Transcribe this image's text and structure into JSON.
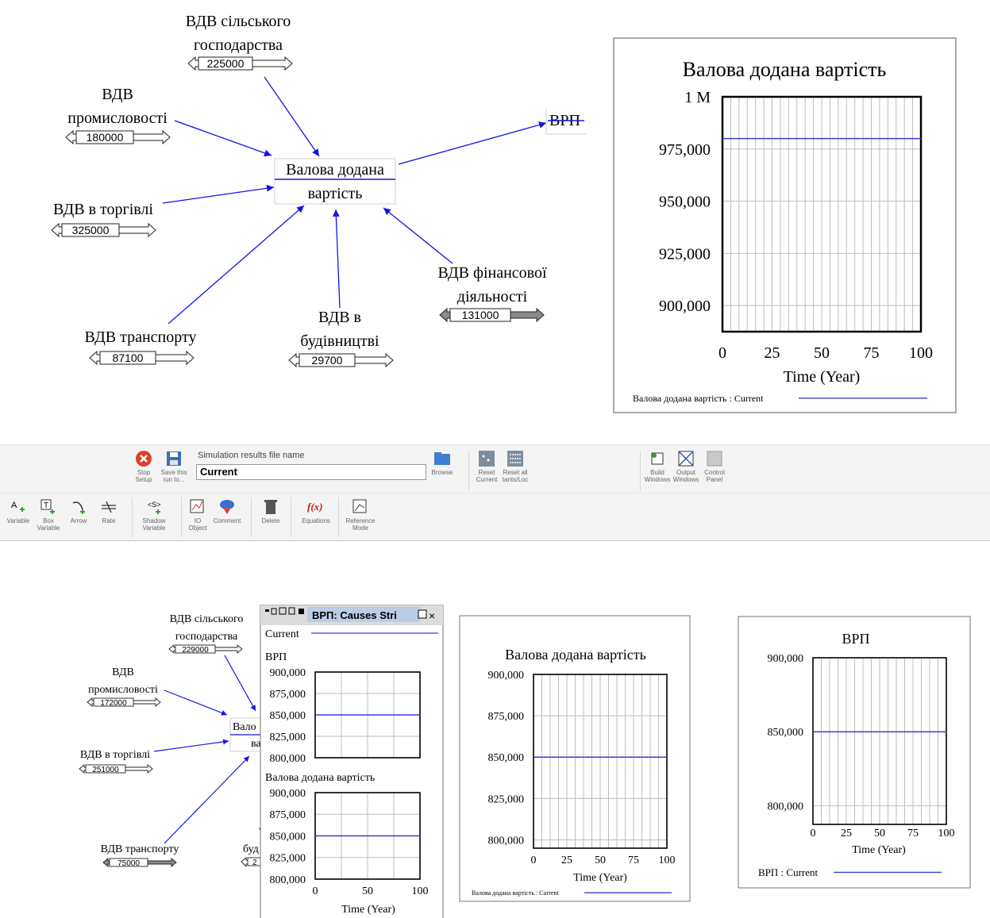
{
  "top_diagram": {
    "central": {
      "line1": "Валова додана",
      "line2": "вартість"
    },
    "output": "ВРП",
    "inputs": [
      {
        "id": "agri",
        "name_lines": [
          "ВДВ сільського",
          "господарства"
        ],
        "value": "225000"
      },
      {
        "id": "ind",
        "name_lines": [
          "ВДВ",
          "промисловості"
        ],
        "value": "180000"
      },
      {
        "id": "trade",
        "name_lines": [
          "ВДВ в торгівлі"
        ],
        "value": "325000"
      },
      {
        "id": "trans",
        "name_lines": [
          "ВДВ транспорту"
        ],
        "value": "87100"
      },
      {
        "id": "build",
        "name_lines": [
          "ВДВ в",
          "будівництві"
        ],
        "value": "29700"
      },
      {
        "id": "fin",
        "name_lines": [
          "ВДВ фінансової",
          "діяльності"
        ],
        "value": "131000"
      }
    ]
  },
  "toolbar": {
    "stop_label": "Stop Setup",
    "save_label": "Save this run to...",
    "simfile_caption": "Simulation results file name",
    "simfile_value": "Current",
    "browse_label": "Browse",
    "reset_current_label": "Reset Current",
    "reset_all_label": "Reset all tants/Loc",
    "build_windows_label": "Build Windows",
    "output_windows_label": "Output Windows",
    "control_panel_label": "Control Panel",
    "variable_label": "Variable",
    "box_variable_label": "Box Variable",
    "arrow_label": "Arrow",
    "rate_label": "Rate",
    "shadow_variable_label": "Shadow Variable",
    "io_object_label": "IO Object",
    "comment_label": "Comment",
    "delete_label": "Delete",
    "equations_label": "Equations",
    "reference_mode_label": "Reference Mode"
  },
  "bottom_diagram": {
    "central_partial": {
      "line1": "Вало",
      "line2": "ва"
    },
    "inputs": [
      {
        "id": "agri2",
        "name_lines": [
          "ВДВ сільського",
          "господарства"
        ],
        "value": "229000"
      },
      {
        "id": "ind2",
        "name_lines": [
          "ВДВ",
          "промисловості"
        ],
        "value": "172000"
      },
      {
        "id": "trade2",
        "name_lines": [
          "ВДВ в торгівлі"
        ],
        "value": "251000"
      },
      {
        "id": "trans2",
        "name_lines": [
          "ВДВ транспорту"
        ],
        "value": "75000"
      }
    ],
    "partial_label": "буд",
    "partial_value": "2"
  },
  "causes_window": {
    "title": "ВРП: Causes Stri",
    "legend_label": "Current",
    "panel1_title": "ВРП",
    "panel2_title": "Валова додана вартість",
    "xlabel": "Time (Year)"
  },
  "chart_data": [
    {
      "type": "line",
      "title": "Валова додана вартість",
      "xlabel": "Time (Year)",
      "ylabel": "",
      "xlim": [
        0,
        100
      ],
      "ylim": [
        887500,
        1000000
      ],
      "y_ticks": [
        {
          "v": 1000000,
          "label": "1 M"
        },
        {
          "v": 975000,
          "label": "975,000"
        },
        {
          "v": 950000,
          "label": "950,000"
        },
        {
          "v": 925000,
          "label": "925,000"
        },
        {
          "v": 900000,
          "label": "900,000"
        }
      ],
      "x_ticks": [
        0,
        25,
        50,
        75,
        100
      ],
      "grid": true,
      "legend_text": "Валова додана вартість : Current",
      "series": [
        {
          "name": "Валова додана вартість : Current",
          "color": "#3b3bd6",
          "x": [
            0,
            100
          ],
          "y": [
            980000,
            980000
          ]
        }
      ]
    },
    {
      "type": "line",
      "title": "ВРП",
      "xlabel": "Time (Year)",
      "xlim": [
        0,
        100
      ],
      "ylim": [
        800000,
        900000
      ],
      "y_ticks": [
        {
          "v": 900000,
          "label": "900,000"
        },
        {
          "v": 875000,
          "label": "875,000"
        },
        {
          "v": 850000,
          "label": "850,000"
        },
        {
          "v": 825000,
          "label": "825,000"
        },
        {
          "v": 800000,
          "label": "800,000"
        }
      ],
      "x_ticks": [
        0,
        50,
        100
      ],
      "grid": true,
      "series": [
        {
          "name": "Current",
          "color": "#3b3bd6",
          "x": [
            0,
            100
          ],
          "y": [
            850000,
            850000
          ]
        }
      ]
    },
    {
      "type": "line",
      "title": "Валова додана вартість",
      "xlabel": "Time (Year)",
      "xlim": [
        0,
        100
      ],
      "ylim": [
        800000,
        900000
      ],
      "y_ticks": [
        {
          "v": 900000,
          "label": "900,000"
        },
        {
          "v": 875000,
          "label": "875,000"
        },
        {
          "v": 850000,
          "label": "850,000"
        },
        {
          "v": 825000,
          "label": "825,000"
        },
        {
          "v": 800000,
          "label": "800,000"
        }
      ],
      "x_ticks": [
        0,
        50,
        100
      ],
      "grid": true,
      "series": [
        {
          "name": "Current",
          "color": "#3b3bd6",
          "x": [
            0,
            100
          ],
          "y": [
            850000,
            850000
          ]
        }
      ]
    },
    {
      "type": "line",
      "title": "Валова додана вартість",
      "xlabel": "Time (Year)",
      "xlim": [
        0,
        100
      ],
      "ylim": [
        795000,
        900000
      ],
      "y_ticks": [
        {
          "v": 900000,
          "label": "900,000"
        },
        {
          "v": 875000,
          "label": "875,000"
        },
        {
          "v": 850000,
          "label": "850,000"
        },
        {
          "v": 825000,
          "label": "825,000"
        },
        {
          "v": 800000,
          "label": "800,000"
        }
      ],
      "x_ticks": [
        0,
        25,
        50,
        75,
        100
      ],
      "grid": true,
      "legend_text": "Валова додана вартість : Current",
      "series": [
        {
          "name": "Валова додана вартість : Current",
          "color": "#3b3bd6",
          "x": [
            0,
            100
          ],
          "y": [
            850000,
            850000
          ]
        }
      ]
    },
    {
      "type": "line",
      "title": "ВРП",
      "xlabel": "Time (Year)",
      "xlim": [
        0,
        100
      ],
      "ylim": [
        787500,
        900000
      ],
      "y_ticks": [
        {
          "v": 900000,
          "label": "900,000"
        },
        {
          "v": 850000,
          "label": "850,000"
        },
        {
          "v": 800000,
          "label": "800,000"
        }
      ],
      "x_ticks": [
        0,
        25,
        50,
        75,
        100
      ],
      "grid": true,
      "legend_text": "ВРП : Current",
      "series": [
        {
          "name": "ВРП : Current",
          "color": "#3b3bd6",
          "x": [
            0,
            100
          ],
          "y": [
            850000,
            850000
          ]
        }
      ]
    }
  ]
}
